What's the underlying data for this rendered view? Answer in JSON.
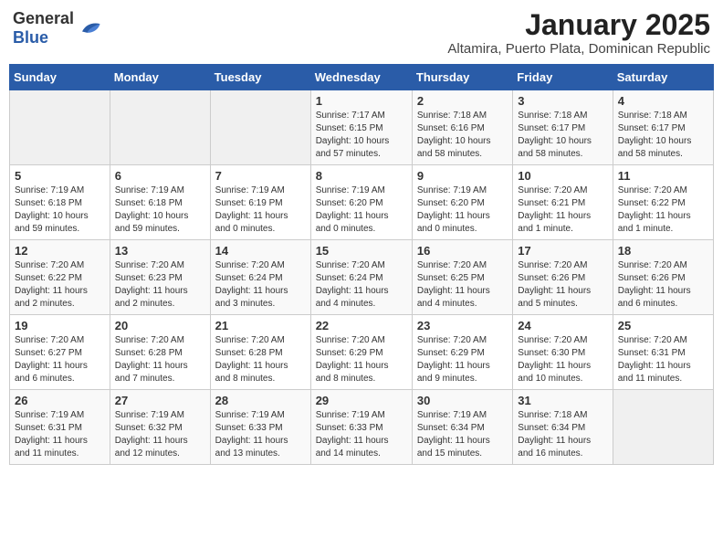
{
  "header": {
    "logo_general": "General",
    "logo_blue": "Blue",
    "month": "January 2025",
    "location": "Altamira, Puerto Plata, Dominican Republic"
  },
  "weekdays": [
    "Sunday",
    "Monday",
    "Tuesday",
    "Wednesday",
    "Thursday",
    "Friday",
    "Saturday"
  ],
  "weeks": [
    [
      {
        "day": "",
        "info": ""
      },
      {
        "day": "",
        "info": ""
      },
      {
        "day": "",
        "info": ""
      },
      {
        "day": "1",
        "info": "Sunrise: 7:17 AM\nSunset: 6:15 PM\nDaylight: 10 hours\nand 57 minutes."
      },
      {
        "day": "2",
        "info": "Sunrise: 7:18 AM\nSunset: 6:16 PM\nDaylight: 10 hours\nand 58 minutes."
      },
      {
        "day": "3",
        "info": "Sunrise: 7:18 AM\nSunset: 6:17 PM\nDaylight: 10 hours\nand 58 minutes."
      },
      {
        "day": "4",
        "info": "Sunrise: 7:18 AM\nSunset: 6:17 PM\nDaylight: 10 hours\nand 58 minutes."
      }
    ],
    [
      {
        "day": "5",
        "info": "Sunrise: 7:19 AM\nSunset: 6:18 PM\nDaylight: 10 hours\nand 59 minutes."
      },
      {
        "day": "6",
        "info": "Sunrise: 7:19 AM\nSunset: 6:18 PM\nDaylight: 10 hours\nand 59 minutes."
      },
      {
        "day": "7",
        "info": "Sunrise: 7:19 AM\nSunset: 6:19 PM\nDaylight: 11 hours\nand 0 minutes."
      },
      {
        "day": "8",
        "info": "Sunrise: 7:19 AM\nSunset: 6:20 PM\nDaylight: 11 hours\nand 0 minutes."
      },
      {
        "day": "9",
        "info": "Sunrise: 7:19 AM\nSunset: 6:20 PM\nDaylight: 11 hours\nand 0 minutes."
      },
      {
        "day": "10",
        "info": "Sunrise: 7:20 AM\nSunset: 6:21 PM\nDaylight: 11 hours\nand 1 minute."
      },
      {
        "day": "11",
        "info": "Sunrise: 7:20 AM\nSunset: 6:22 PM\nDaylight: 11 hours\nand 1 minute."
      }
    ],
    [
      {
        "day": "12",
        "info": "Sunrise: 7:20 AM\nSunset: 6:22 PM\nDaylight: 11 hours\nand 2 minutes."
      },
      {
        "day": "13",
        "info": "Sunrise: 7:20 AM\nSunset: 6:23 PM\nDaylight: 11 hours\nand 2 minutes."
      },
      {
        "day": "14",
        "info": "Sunrise: 7:20 AM\nSunset: 6:24 PM\nDaylight: 11 hours\nand 3 minutes."
      },
      {
        "day": "15",
        "info": "Sunrise: 7:20 AM\nSunset: 6:24 PM\nDaylight: 11 hours\nand 4 minutes."
      },
      {
        "day": "16",
        "info": "Sunrise: 7:20 AM\nSunset: 6:25 PM\nDaylight: 11 hours\nand 4 minutes."
      },
      {
        "day": "17",
        "info": "Sunrise: 7:20 AM\nSunset: 6:26 PM\nDaylight: 11 hours\nand 5 minutes."
      },
      {
        "day": "18",
        "info": "Sunrise: 7:20 AM\nSunset: 6:26 PM\nDaylight: 11 hours\nand 6 minutes."
      }
    ],
    [
      {
        "day": "19",
        "info": "Sunrise: 7:20 AM\nSunset: 6:27 PM\nDaylight: 11 hours\nand 6 minutes."
      },
      {
        "day": "20",
        "info": "Sunrise: 7:20 AM\nSunset: 6:28 PM\nDaylight: 11 hours\nand 7 minutes."
      },
      {
        "day": "21",
        "info": "Sunrise: 7:20 AM\nSunset: 6:28 PM\nDaylight: 11 hours\nand 8 minutes."
      },
      {
        "day": "22",
        "info": "Sunrise: 7:20 AM\nSunset: 6:29 PM\nDaylight: 11 hours\nand 8 minutes."
      },
      {
        "day": "23",
        "info": "Sunrise: 7:20 AM\nSunset: 6:29 PM\nDaylight: 11 hours\nand 9 minutes."
      },
      {
        "day": "24",
        "info": "Sunrise: 7:20 AM\nSunset: 6:30 PM\nDaylight: 11 hours\nand 10 minutes."
      },
      {
        "day": "25",
        "info": "Sunrise: 7:20 AM\nSunset: 6:31 PM\nDaylight: 11 hours\nand 11 minutes."
      }
    ],
    [
      {
        "day": "26",
        "info": "Sunrise: 7:19 AM\nSunset: 6:31 PM\nDaylight: 11 hours\nand 11 minutes."
      },
      {
        "day": "27",
        "info": "Sunrise: 7:19 AM\nSunset: 6:32 PM\nDaylight: 11 hours\nand 12 minutes."
      },
      {
        "day": "28",
        "info": "Sunrise: 7:19 AM\nSunset: 6:33 PM\nDaylight: 11 hours\nand 13 minutes."
      },
      {
        "day": "29",
        "info": "Sunrise: 7:19 AM\nSunset: 6:33 PM\nDaylight: 11 hours\nand 14 minutes."
      },
      {
        "day": "30",
        "info": "Sunrise: 7:19 AM\nSunset: 6:34 PM\nDaylight: 11 hours\nand 15 minutes."
      },
      {
        "day": "31",
        "info": "Sunrise: 7:18 AM\nSunset: 6:34 PM\nDaylight: 11 hours\nand 16 minutes."
      },
      {
        "day": "",
        "info": ""
      }
    ]
  ]
}
